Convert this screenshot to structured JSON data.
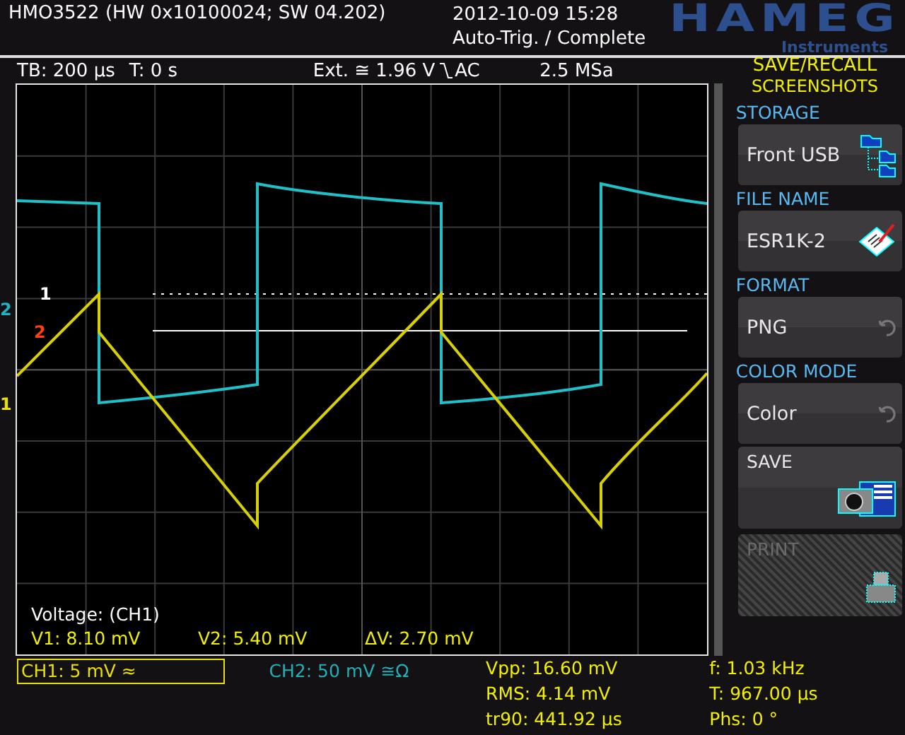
{
  "header": {
    "device": "HMO3522 (HW 0x10100024; SW 04.202)",
    "datetime": "2012-10-09 15:28",
    "status": "Auto-Trig. / Complete",
    "logo": "HAMEG",
    "logo_sub": "Instruments"
  },
  "top_bar": {
    "timebase": "TB: 200 µs",
    "time_offset": "T: 0 s",
    "trigger_source": "Ext. ≅ 1.96 V",
    "trigger_coupling": "AC",
    "sample_rate": "2.5 MSa"
  },
  "screen": {
    "cursor_markers": [
      {
        "label": "1",
        "color": "#ffffff"
      },
      {
        "label": "2",
        "color": "#ff4010"
      }
    ],
    "channel_markers": [
      {
        "label": "2",
        "color": "#20b4c0"
      },
      {
        "label": "1",
        "color": "#e8e000"
      }
    ],
    "cursor_readout": {
      "title": "Voltage: (CH1)",
      "values": [
        "V1: 8.10 mV",
        "V2: 5.40 mV",
        "ΔV: 2.70 mV"
      ]
    }
  },
  "menu": {
    "title": "SAVE/RECALL",
    "subtitle": "SCREENSHOTS",
    "items": [
      {
        "kind": "select",
        "heading": "STORAGE",
        "value": "Front USB",
        "disabled": false
      },
      {
        "kind": "select",
        "heading": "FILE NAME",
        "value": "ESR1K-2",
        "disabled": false
      },
      {
        "kind": "toggle",
        "heading": "FORMAT",
        "value": "PNG",
        "disabled": false
      },
      {
        "kind": "toggle",
        "heading": "COLOR MODE",
        "value": "Color",
        "disabled": false
      },
      {
        "kind": "action",
        "label": "SAVE",
        "disabled": false
      },
      {
        "kind": "action",
        "label": "PRINT",
        "disabled": true
      }
    ]
  },
  "channels": [
    {
      "label": "CH1: 5 mV ≈",
      "selected": true,
      "color": "#e8e000"
    },
    {
      "label": "CH2: 50 mV ≅Ω",
      "selected": false,
      "color": "#20b0b8"
    }
  ],
  "measurements": [
    [
      "Vpp: 16.60 mV",
      "RMS: 4.14 mV",
      "tr90: 441.92 µs"
    ],
    [
      "f: 1.03 kHz",
      "T: 967.00 µs",
      "Phs: 0 °"
    ]
  ]
}
